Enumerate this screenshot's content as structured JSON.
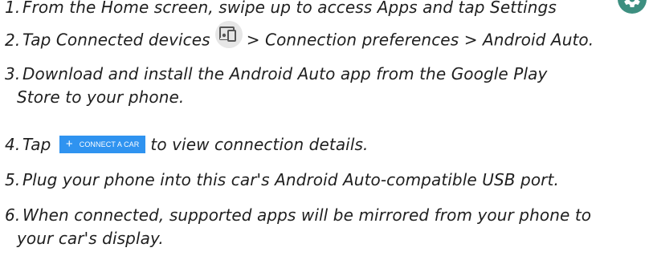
{
  "steps": [
    {
      "number": "1.",
      "text": "From the Home screen, swipe up to access Apps and tap Settings"
    },
    {
      "number": "2.",
      "text_before": "Tap Connected devices",
      "text_after": "> Connection preferences > Android Auto."
    },
    {
      "number": "3.",
      "line1": "Download and install the Android Auto app from the Google Play",
      "line2": "Store to your phone."
    },
    {
      "number": "4.",
      "text_before": "Tap",
      "text_after": "to view connection details."
    },
    {
      "number": "5.",
      "text": "Plug your phone into this car's Android Auto-compatible USB port."
    },
    {
      "number": "6.",
      "line1": "When connected, supported apps will be mirrored from your phone to",
      "line2": "your car's display."
    }
  ],
  "connect_button": {
    "icon": "+",
    "label": "CONNECT A CAR"
  },
  "icons": {
    "settings": "settings-gear-icon",
    "connected_devices": "connected-devices-icon"
  },
  "colors": {
    "settings_icon_bg": "#3d8f80",
    "connect_button_bg": "#2f93f0"
  }
}
